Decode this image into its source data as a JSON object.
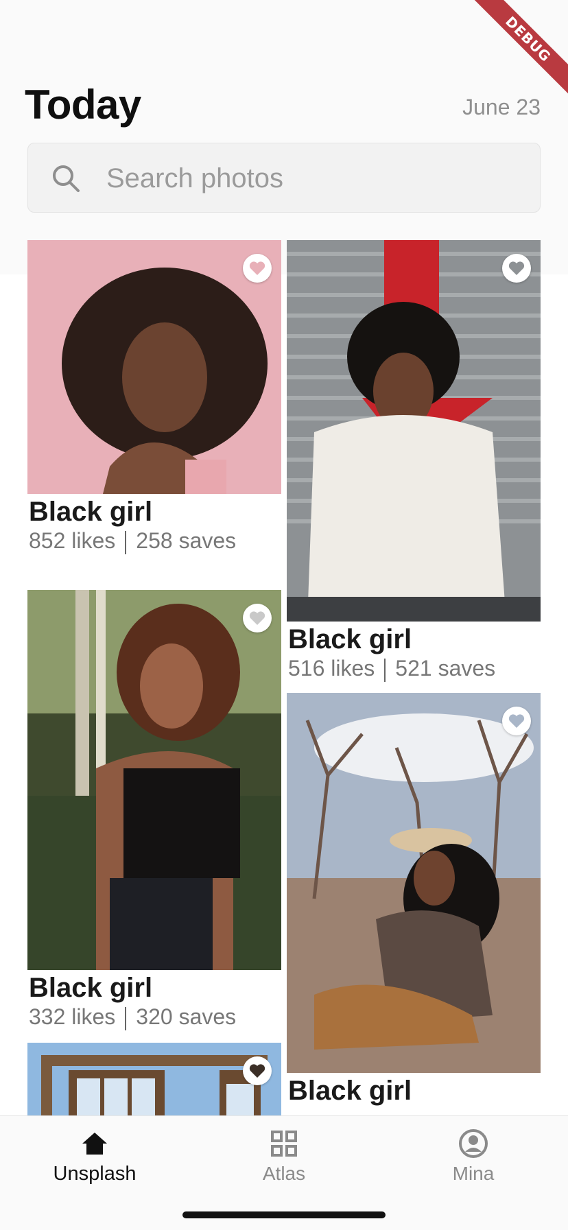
{
  "debug_banner": "DEBUG",
  "header": {
    "title": "Today",
    "date": "June 23"
  },
  "search": {
    "placeholder": "Search photos",
    "icon": "search-icon"
  },
  "feed": {
    "cards": [
      {
        "title": "Black girl",
        "likes": "852 likes",
        "saves": "258 saves"
      },
      {
        "title": "Black girl",
        "likes": "516 likes",
        "saves": "521 saves"
      },
      {
        "title": "Black girl",
        "likes": "332 likes",
        "saves": "320 saves"
      },
      {
        "title": "Black girl",
        "likes": "",
        "saves": ""
      },
      {
        "title": "",
        "likes": "",
        "saves": ""
      }
    ]
  },
  "bottom_nav": {
    "items": [
      {
        "label": "Unsplash",
        "icon": "home-icon",
        "active": true
      },
      {
        "label": "Atlas",
        "icon": "grid-icon",
        "active": false
      },
      {
        "label": "Mina",
        "icon": "account-icon",
        "active": false
      }
    ]
  },
  "colors": {
    "debug": "#b3262c",
    "text": "#111111",
    "muted": "#8f8f8f"
  }
}
